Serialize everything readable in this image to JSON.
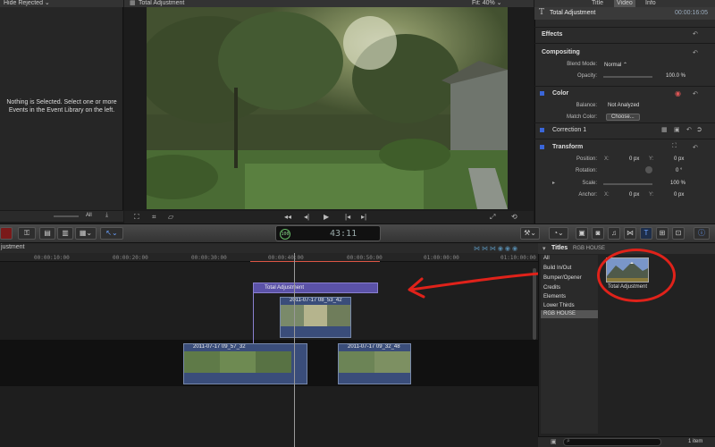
{
  "event_browser": {
    "filter_label": "Hide Rejected",
    "empty_message": "Nothing is Selected. Select one or more Events in the Event Library on the left.",
    "footer_label": "All"
  },
  "viewer": {
    "title": "Total Adjustment",
    "fit_label": "Fit:",
    "zoom": "40%"
  },
  "inspector": {
    "tabs": [
      "Title",
      "Video",
      "Info"
    ],
    "title": "Total Adjustment",
    "timecode": "00:00:16:05",
    "sections": {
      "effects": "Effects",
      "compositing": "Compositing",
      "color": "Color",
      "correction": "Correction 1",
      "transform": "Transform"
    },
    "blend_mode_label": "Blend Mode:",
    "blend_mode_value": "Normal",
    "opacity_label": "Opacity:",
    "opacity_value": "100.0 %",
    "balance_label": "Balance:",
    "balance_value": "Not Analyzed",
    "match_color_label": "Match Color:",
    "match_color_button": "Choose...",
    "position_label": "Position:",
    "position_x": "0 px",
    "position_y": "0 px",
    "x_label": "X:",
    "y_label": "Y:",
    "rotation_label": "Rotation:",
    "rotation_value": "0 °",
    "scale_label": "Scale:",
    "scale_value": "100 %",
    "anchor_label": "Anchor:",
    "anchor_x": "0 px",
    "anchor_y": "0 px"
  },
  "toolbar": {
    "timecode": "43:11",
    "percent": "100"
  },
  "timeline": {
    "title": "justment",
    "ruler_ticks": [
      "00:00:10:00",
      "00:00:20:00",
      "00:00:30:00",
      "00:00:40:00",
      "00:00:50:00",
      "01:00:00:00",
      "01:10:00:00"
    ],
    "adjustment_clip": "Total Adjustment",
    "connected_clip": "2011-07-17 08_53_42",
    "primary_clip_1": "2011-07-17 09_57_32",
    "primary_clip_2": "2011-07-17 09_32_48"
  },
  "title_browser": {
    "header": "Titles",
    "sub_header": "RGB HOUSE",
    "categories": [
      "All",
      "Build In/Out",
      "Bumper/Opener",
      "Credits",
      "Elements",
      "Lower Thirds",
      "RGB HOUSE"
    ],
    "selected_category": "RGB HOUSE",
    "item_label": "Total Adjustment",
    "footer_count": "1 item"
  },
  "colors": {
    "accent_blue": "#3a66d9",
    "adjustment_clip": "#5b52a8",
    "video_clip": "#3a4d7a",
    "annotation_red": "#e0221a"
  }
}
